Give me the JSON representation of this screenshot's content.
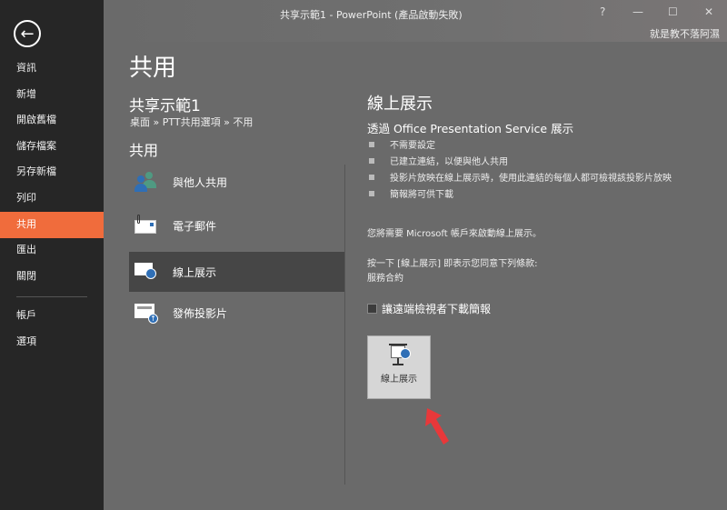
{
  "window": {
    "title": "共享示範1 - PowerPoint (產品啟動失敗)",
    "help": "?",
    "minimize": "—",
    "maximize": "☐",
    "close": "✕",
    "user": "就是教不落阿濕"
  },
  "sidebar": {
    "back": "←",
    "items": [
      {
        "label": "資訊"
      },
      {
        "label": "新增"
      },
      {
        "label": "開啟舊檔"
      },
      {
        "label": "儲存檔案"
      },
      {
        "label": "另存新檔"
      },
      {
        "label": "列印"
      },
      {
        "label": "共用"
      },
      {
        "label": "匯出"
      },
      {
        "label": "關閉"
      },
      {
        "label": "帳戶"
      },
      {
        "label": "選項"
      }
    ],
    "active": "共用",
    "accent": "#f06c3c"
  },
  "main": {
    "heading": "共用",
    "doc_name": "共享示範1",
    "breadcrumb": "桌面 » PTT共用選項 » 不用",
    "section": "共用",
    "options": [
      {
        "label": "與他人共用"
      },
      {
        "label": "電子郵件"
      },
      {
        "label": "線上展示"
      },
      {
        "label": "發佈投影片"
      }
    ]
  },
  "detail": {
    "title": "線上展示",
    "subtitle": "透過 Office Presentation Service 展示",
    "bullets": [
      "不需要設定",
      "已建立連結，以便與他人共用",
      "投影片放映在線上展示時，使用此連結的每個人都可檢視該投影片放映",
      "簡報將可供下載"
    ],
    "account_note": "您將需要 Microsoft 帳戶來啟動線上展示。",
    "agree_note": "按一下 [線上展示] 即表示您同意下列條款:",
    "terms": "服務合約",
    "checkbox_label": "讓遠端檢視者下載簡報",
    "button_label": "線上展示"
  }
}
